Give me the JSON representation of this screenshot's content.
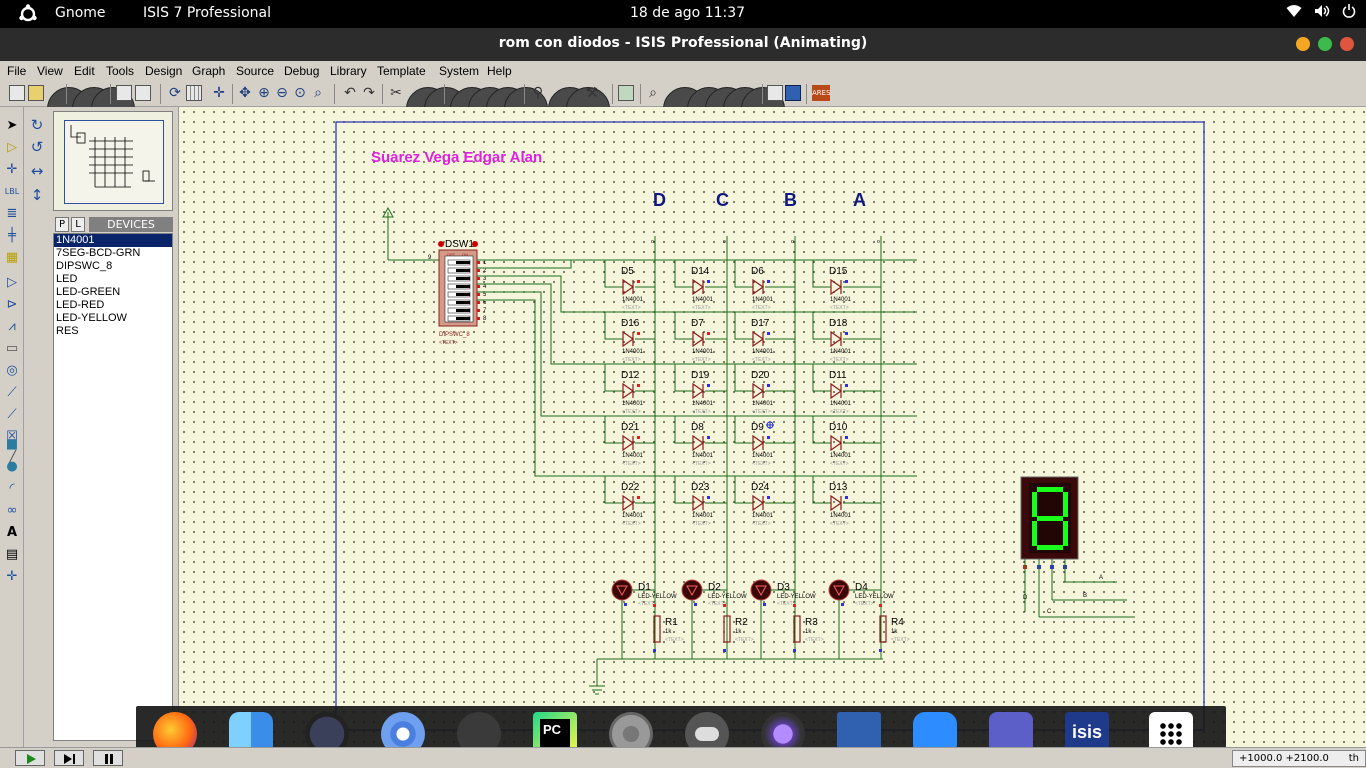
{
  "topbar": {
    "activities_icon": "ubuntu-logo-icon",
    "app1": "Gnome",
    "app2": "ISIS 7 Professional",
    "clock": "18 de ago  11:37",
    "tray_icons": [
      "wifi-icon",
      "volume-icon",
      "power-icon"
    ]
  },
  "window": {
    "title": "rom con diodos - ISIS Professional (Animating)",
    "buttons": [
      "minimize-button",
      "maximize-button",
      "close-button"
    ],
    "colors": {
      "minimize": "#f5a623",
      "maximize": "#3cba4c",
      "close": "#e0553f"
    }
  },
  "menu": [
    "File",
    "View",
    "Edit",
    "Tools",
    "Design",
    "Graph",
    "Source",
    "Debug",
    "Library",
    "Template",
    "System",
    "Help"
  ],
  "devices": {
    "tab_p": "P",
    "tab_l": "L",
    "header": "DEVICES",
    "items": [
      "1N4001",
      "7SEG-BCD-GRN",
      "DIPSWC_8",
      "LED",
      "LED-GREEN",
      "LED-RED",
      "LED-YELLOW",
      "RES"
    ],
    "selected_index": 0
  },
  "schematic": {
    "author": "Suarez Vega Edgar Alan",
    "columns": [
      "D",
      "C",
      "B",
      "A"
    ],
    "switch_label": "DSW1",
    "switch_part": "DIPSWC_8",
    "switch_off": "OFF",
    "switch_on": "ON",
    "switch_pins": [
      "1",
      "2",
      "3",
      "4",
      "5",
      "6",
      "7",
      "8"
    ],
    "pin_left": "9",
    "diode_part": "1N4001",
    "text_placeholder": "<TEXT>",
    "diode_rows": [
      [
        "D5",
        "D14",
        "D6",
        "D15"
      ],
      [
        "D16",
        "D7",
        "D17",
        "D18"
      ],
      [
        "D12",
        "D19",
        "D20",
        "D11"
      ],
      [
        "D21",
        "D8",
        "D9",
        "D10"
      ],
      [
        "D22",
        "D23",
        "D24",
        "D13"
      ]
    ],
    "leds": [
      "D1",
      "D2",
      "D3",
      "D4"
    ],
    "led_part": "LED-YELLOW",
    "resistors": [
      "R1",
      "R2",
      "R3",
      "R4"
    ],
    "res_value": "1k",
    "seven_seg_digit": "8",
    "seven_seg_inputs": [
      "A",
      "B",
      "C",
      "D"
    ],
    "bus_letter": "o"
  },
  "status": {
    "coords": "+1000.0  +2100.0",
    "unit": "th"
  },
  "dock_apps": [
    "firefox-icon",
    "finder-icon",
    "speedometer-icon",
    "chromium-icon",
    "terminal-icon",
    "pycharm-icon",
    "settings-icon",
    "toggle-icon",
    "camera-icon",
    "document-viewer-icon",
    "zoom-icon",
    "teams-icon",
    "isis-icon",
    "app-grid-icon"
  ],
  "dock_labels": {
    "pycharm": "PC",
    "isis": "isis"
  }
}
